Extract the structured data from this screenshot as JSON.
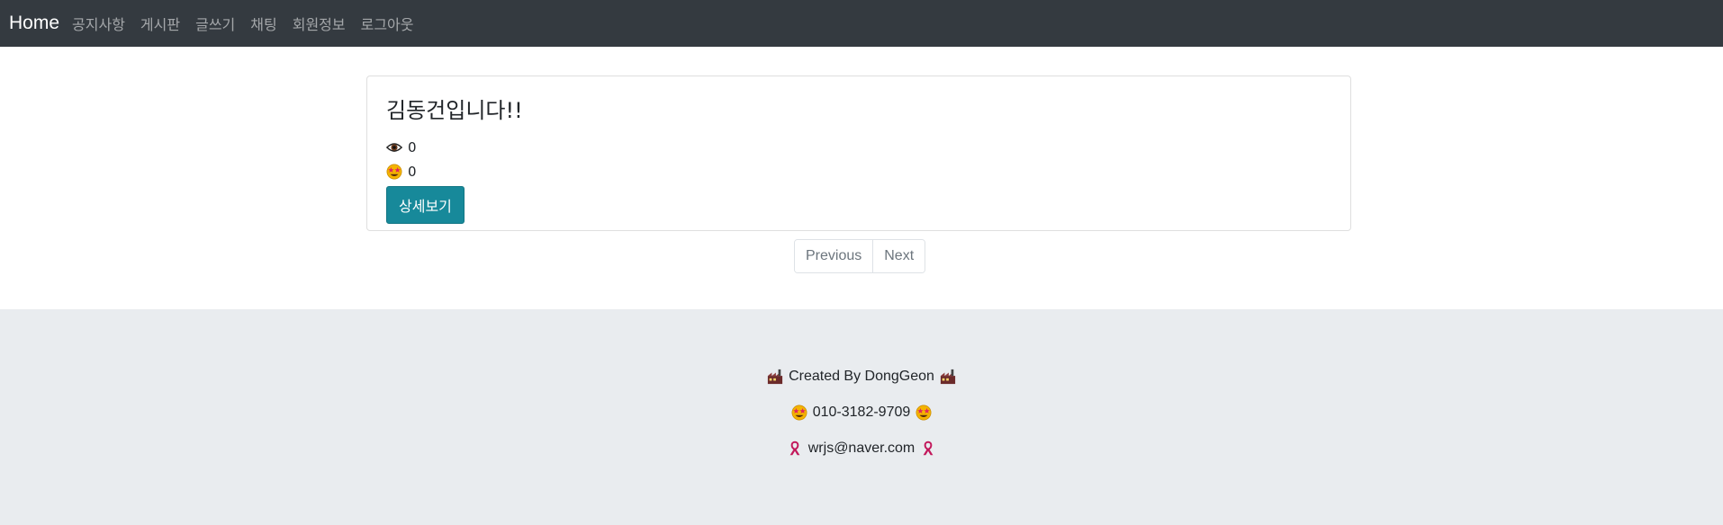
{
  "navbar": {
    "brand": "Home",
    "links": [
      "공지사항",
      "게시판",
      "글쓰기",
      "채팅",
      "회원정보",
      "로그아웃"
    ]
  },
  "post": {
    "title": "김동건입니다!!",
    "views": "0",
    "likes": "0",
    "detail_button": "상세보기",
    "view_icon": "eye-icon",
    "like_icon": "star-struck-face-icon"
  },
  "pagination": {
    "previous": "Previous",
    "next": "Next"
  },
  "footer": {
    "created_by": "Created By DongGeon",
    "phone": "010-3182-9709",
    "email": "wrjs@naver.com",
    "created_icon": "factory-icon",
    "phone_icon": "star-struck-face-icon",
    "email_icon": "ribbon-icon"
  },
  "colors": {
    "navbar_bg": "#343a40",
    "button_bg": "#17899a",
    "footer_bg": "#e9ecef"
  }
}
